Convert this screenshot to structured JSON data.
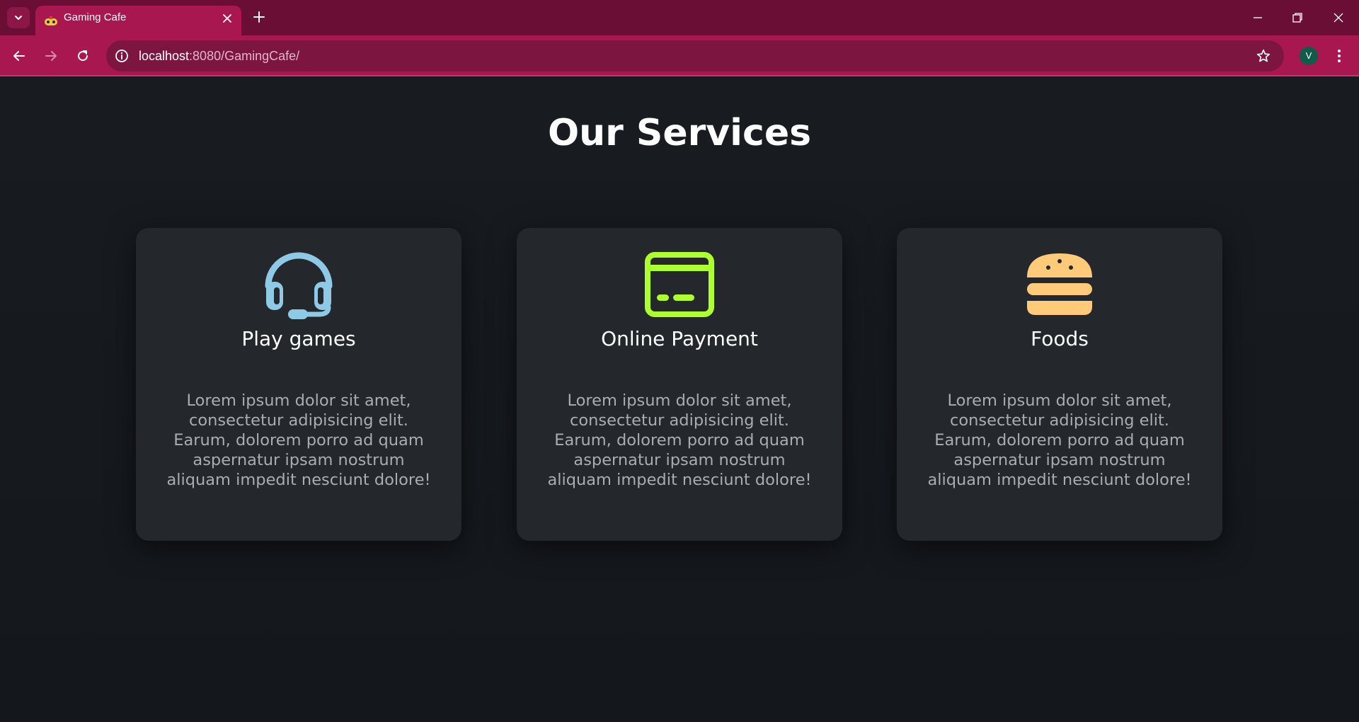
{
  "browser": {
    "tab_title": "Gaming Cafe",
    "url_host": "localhost",
    "url_path": ":8080/GamingCafe/",
    "profile_initial": "V",
    "icons": {
      "tab_search": "chevron-down-icon",
      "favicon": "game-controller-icon",
      "tab_close": "close-icon",
      "new_tab": "plus-icon",
      "back": "arrow-left-icon",
      "forward": "arrow-right-icon",
      "reload": "reload-icon",
      "site_info": "info-icon",
      "bookmark": "star-icon",
      "menu": "kebab-menu-icon"
    },
    "colors": {
      "tab_strip": "#6a0e36",
      "toolbar": "#a8174f"
    }
  },
  "page": {
    "title": "Our Services",
    "background": "#161a1f",
    "services": [
      {
        "title": "Play games",
        "icon": "headset-icon",
        "icon_color": "#8ecae6",
        "text": "Lorem ipsum dolor sit amet, consectetur adipisicing elit. Earum, dolorem porro ad quam aspernatur ipsam nostrum aliquam impedit nesciunt dolore!"
      },
      {
        "title": "Online Payment",
        "icon": "credit-card-icon",
        "icon_color": "#adff2f",
        "text": "Lorem ipsum dolor sit amet, consectetur adipisicing elit. Earum, dolorem porro ad quam aspernatur ipsam nostrum aliquam impedit nesciunt dolore!"
      },
      {
        "title": "Foods",
        "icon": "burger-icon",
        "icon_color": "#ffcb7a",
        "text": "Lorem ipsum dolor sit amet, consectetur adipisicing elit. Earum, dolorem porro ad quam aspernatur ipsam nostrum aliquam impedit nesciunt dolore!"
      }
    ]
  }
}
